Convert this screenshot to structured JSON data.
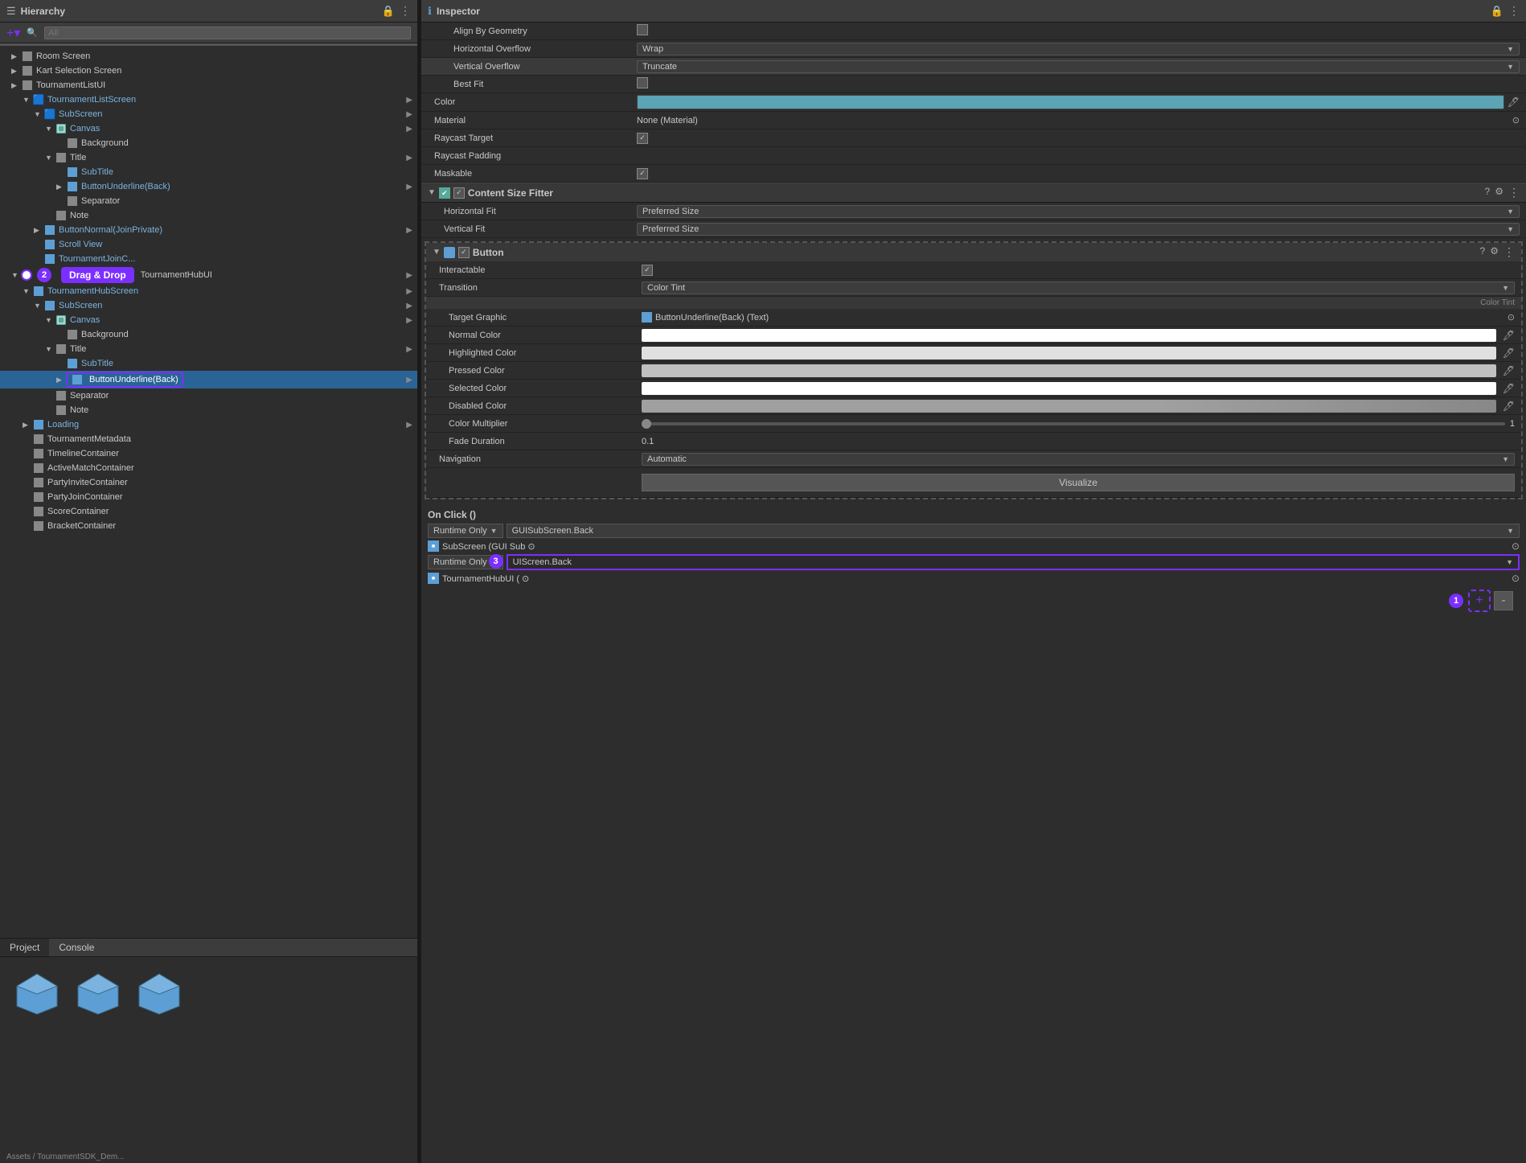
{
  "hierarchy": {
    "title": "Hierarchy",
    "search_placeholder": "All",
    "items": [
      {
        "id": "room-screen",
        "label": "Room Screen",
        "depth": 1,
        "has_arrow": true,
        "type": "cube_gray"
      },
      {
        "id": "kart-selection",
        "label": "Kart Selection Screen",
        "depth": 1,
        "has_arrow": true,
        "type": "cube_gray"
      },
      {
        "id": "tournament-list-ui",
        "label": "TournamentListUI",
        "depth": 1,
        "has_arrow": true,
        "type": "cube_gray"
      },
      {
        "id": "tournament-list-screen",
        "label": "TournamentListScreen",
        "depth": 2,
        "has_arrow": true,
        "type": "cube_blue"
      },
      {
        "id": "subscreen1",
        "label": "SubScreen",
        "depth": 3,
        "has_arrow": true,
        "type": "cube_blue"
      },
      {
        "id": "canvas1",
        "label": "Canvas",
        "depth": 4,
        "has_arrow": true,
        "type": "canvas"
      },
      {
        "id": "background1",
        "label": "Background",
        "depth": 5,
        "has_arrow": false,
        "type": "cube_gray"
      },
      {
        "id": "title1",
        "label": "Title",
        "depth": 4,
        "has_arrow": true,
        "type": "cube_gray"
      },
      {
        "id": "subtitle1",
        "label": "SubTitle",
        "depth": 5,
        "has_arrow": false,
        "type": "cube_blue"
      },
      {
        "id": "button-underline-back1",
        "label": "ButtonUnderline(Back)",
        "depth": 5,
        "has_arrow": true,
        "type": "cube_blue"
      },
      {
        "id": "separator1",
        "label": "Separator",
        "depth": 5,
        "has_arrow": false,
        "type": "cube_gray"
      },
      {
        "id": "note1",
        "label": "Note",
        "depth": 4,
        "has_arrow": false,
        "type": "cube_gray"
      },
      {
        "id": "button-normal",
        "label": "ButtonNormal(JoinPrivate)",
        "depth": 3,
        "has_arrow": true,
        "type": "cube_blue"
      },
      {
        "id": "scroll-view",
        "label": "Scroll View",
        "depth": 3,
        "has_arrow": false,
        "type": "cube_blue"
      },
      {
        "id": "tournament-join",
        "label": "TournamentJoinC...",
        "depth": 3,
        "has_arrow": false,
        "type": "cube_blue"
      },
      {
        "id": "tournament-hub-ui",
        "label": "TournamentHubUI",
        "depth": 1,
        "has_arrow": true,
        "type": "cube_gray",
        "drag_drop": true
      },
      {
        "id": "tournament-hub-screen",
        "label": "TournamentHubScreen",
        "depth": 2,
        "has_arrow": true,
        "type": "cube_blue"
      },
      {
        "id": "subscreen2",
        "label": "SubScreen",
        "depth": 3,
        "has_arrow": true,
        "type": "cube_blue"
      },
      {
        "id": "canvas2",
        "label": "Canvas",
        "depth": 4,
        "has_arrow": true,
        "type": "canvas"
      },
      {
        "id": "background2",
        "label": "Background",
        "depth": 5,
        "has_arrow": false,
        "type": "cube_gray"
      },
      {
        "id": "title2",
        "label": "Title",
        "depth": 4,
        "has_arrow": true,
        "type": "cube_gray"
      },
      {
        "id": "subtitle2",
        "label": "SubTitle",
        "depth": 5,
        "has_arrow": false,
        "type": "cube_blue"
      },
      {
        "id": "button-underline-back-selected",
        "label": "ButtonUnderline(Back)",
        "depth": 5,
        "has_arrow": true,
        "type": "cube_blue",
        "selected": true,
        "highlight": true
      },
      {
        "id": "separator2",
        "label": "Separator",
        "depth": 4,
        "has_arrow": false,
        "type": "cube_gray"
      },
      {
        "id": "note2",
        "label": "Note",
        "depth": 4,
        "has_arrow": false,
        "type": "cube_gray"
      },
      {
        "id": "loading",
        "label": "Loading",
        "depth": 2,
        "has_arrow": true,
        "type": "cube_blue"
      },
      {
        "id": "tournament-metadata",
        "label": "TournamentMetadata",
        "depth": 2,
        "has_arrow": false,
        "type": "cube_gray"
      },
      {
        "id": "timeline-container",
        "label": "TimelineContainer",
        "depth": 2,
        "has_arrow": false,
        "type": "cube_gray"
      },
      {
        "id": "active-match",
        "label": "ActiveMatchContainer",
        "depth": 2,
        "has_arrow": false,
        "type": "cube_gray"
      },
      {
        "id": "party-invite",
        "label": "PartyInviteContainer",
        "depth": 2,
        "has_arrow": false,
        "type": "cube_gray"
      },
      {
        "id": "party-join",
        "label": "PartyJoinContainer",
        "depth": 2,
        "has_arrow": false,
        "type": "cube_gray"
      },
      {
        "id": "score-container",
        "label": "ScoreContainer",
        "depth": 2,
        "has_arrow": false,
        "type": "cube_gray"
      },
      {
        "id": "bracket-container",
        "label": "BracketContainer",
        "depth": 2,
        "has_arrow": false,
        "type": "cube_gray"
      }
    ]
  },
  "inspector": {
    "title": "Inspector",
    "sections": {
      "text_component": {
        "align_by_geometry": "Align By Geometry",
        "horizontal_overflow": "Horizontal Overflow",
        "horizontal_overflow_value": "Wrap",
        "vertical_overflow": "Vertical Overflow",
        "vertical_overflow_value": "Truncate",
        "best_fit": "Best Fit",
        "color": "Color",
        "color_value": "#5ba3b5",
        "material": "Material",
        "material_value": "None (Material)",
        "raycast_target": "Raycast Target",
        "raycast_padding": "Raycast Padding",
        "maskable": "Maskable"
      },
      "content_size_fitter": {
        "title": "Content Size Fitter",
        "horizontal_fit": "Horizontal Fit",
        "horizontal_fit_value": "Preferred Size",
        "vertical_fit": "Vertical Fit",
        "vertical_fit_value": "Preferred Size"
      },
      "button": {
        "title": "Button",
        "interactable": "Interactable",
        "transition": "Transition",
        "transition_value": "Color Tint",
        "target_graphic": "Target Graphic",
        "target_graphic_value": "ButtonUnderline(Back) (Text)",
        "normal_color": "Normal Color",
        "highlighted_color": "Highlighted Color",
        "pressed_color": "Pressed Color",
        "selected_color": "Selected Color",
        "disabled_color": "Disabled Color",
        "color_multiplier": "Color Multiplier",
        "color_multiplier_value": "1",
        "fade_duration": "Fade Duration",
        "fade_duration_value": "0.1",
        "navigation": "Navigation",
        "navigation_value": "Automatic",
        "visualize_label": "Visualize"
      },
      "on_click": {
        "title": "On Click ()",
        "runtime_only_1": "Runtime Only",
        "function_1": "GUISubScreen.Back",
        "ref_1": "SubScreen (GUI Sub ⊙",
        "runtime_only_2": "Runtime Only",
        "function_2": "UIScreen.Back",
        "ref_2": "TournamentHubUI ( ⊙",
        "add_label": "+",
        "remove_label": "-"
      }
    }
  },
  "bottom": {
    "project_tab": "Project",
    "console_tab": "Console",
    "add_btn": "+",
    "assets_path": "Assets / TournamentSDK_Dem..."
  },
  "badges": {
    "drag_drop": "Drag & Drop",
    "number_2": "2",
    "number_3": "3",
    "number_1": "1"
  }
}
